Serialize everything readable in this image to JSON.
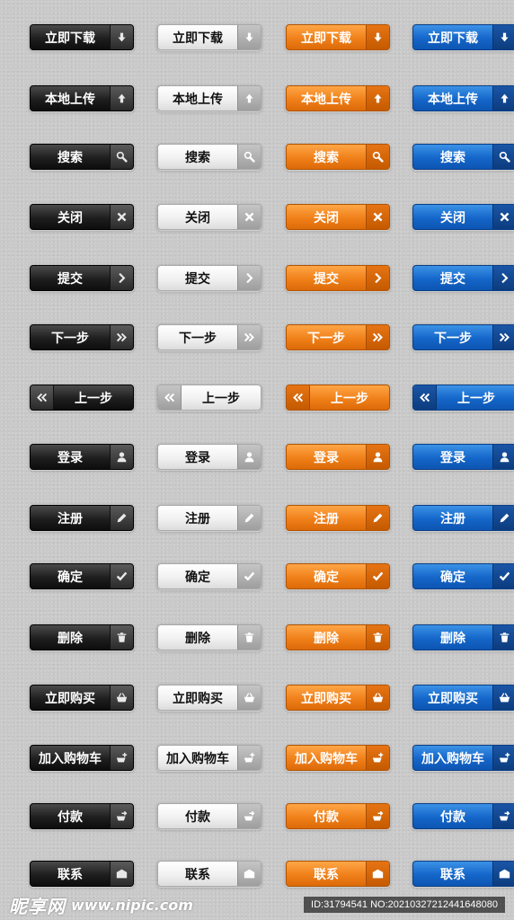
{
  "themes": [
    "black",
    "white",
    "orange",
    "blue"
  ],
  "rows": [
    {
      "label": "立即下载",
      "icon": "download-arrow-icon"
    },
    {
      "label": "本地上传",
      "icon": "upload-arrow-icon"
    },
    {
      "label": "搜索",
      "icon": "search-icon"
    },
    {
      "label": "关闭",
      "icon": "close-icon"
    },
    {
      "label": "提交",
      "icon": "chevron-right-icon"
    },
    {
      "label": "下一步",
      "icon": "double-chevron-right-icon"
    },
    {
      "label": "上一步",
      "icon": "double-chevron-left-icon"
    },
    {
      "label": "登录",
      "icon": "user-icon"
    },
    {
      "label": "注册",
      "icon": "pencil-icon"
    },
    {
      "label": "确定",
      "icon": "checkmark-icon"
    },
    {
      "label": "删除",
      "icon": "trash-icon"
    },
    {
      "label": "立即购买",
      "icon": "basket-icon"
    },
    {
      "label": "加入购物车",
      "icon": "basket-plus-icon"
    },
    {
      "label": "付款",
      "icon": "basket-arrow-icon"
    },
    {
      "label": "联系",
      "icon": "envelope-icon"
    }
  ],
  "colors": {
    "black": "#1e1e1e",
    "white": "#f1f1f1",
    "orange": "#f0801a",
    "blue": "#1466c9"
  },
  "watermark": {
    "logo": "昵享网",
    "url": "www.nipic.com",
    "id_text": "ID:31794541 NO:20210327212441648080"
  }
}
